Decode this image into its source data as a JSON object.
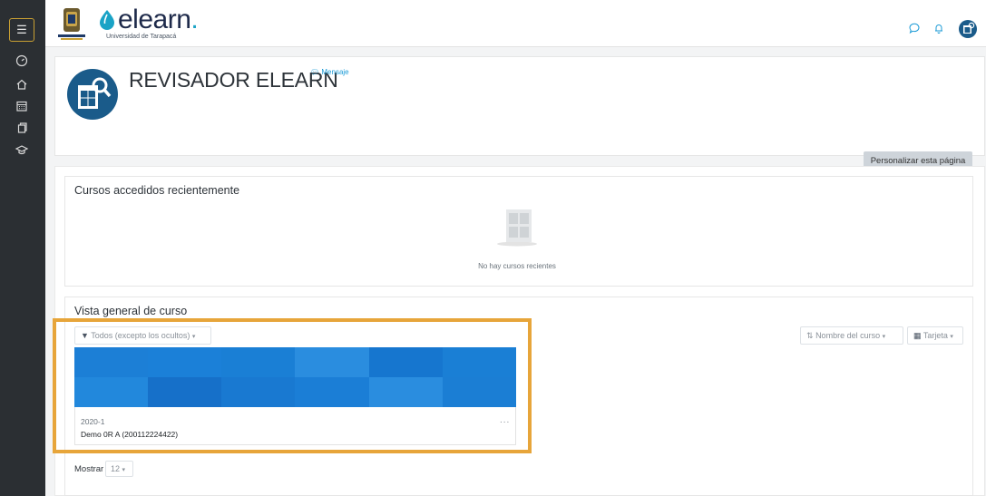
{
  "sidebar": {
    "menu_icon": "hamburger-icon",
    "items": [
      {
        "name": "dashboard",
        "icon": "gauge-icon"
      },
      {
        "name": "home",
        "icon": "home-icon"
      },
      {
        "name": "calendar",
        "icon": "calendar-icon"
      },
      {
        "name": "files",
        "icon": "files-icon"
      },
      {
        "name": "courses",
        "icon": "graduation-cap-icon"
      }
    ]
  },
  "header": {
    "logo_text": "elearn",
    "logo_dot": ".",
    "logo_subtitle": "Universidad de Tarapacá",
    "seal_text": "UNIVERSIDAD DE TARAPACÁ",
    "icons": [
      "chat-icon",
      "bell-icon",
      "user-avatar-icon"
    ]
  },
  "profile": {
    "name": "REVISADOR ELEARN",
    "message_link": "Mensaje",
    "customize_button": "Personalizar esta página"
  },
  "recent_courses": {
    "title": "Cursos accedidos recientemente",
    "empty_text": "No hay cursos recientes"
  },
  "course_overview": {
    "title": "Vista general de curso",
    "filter_label": "Todos (excepto los ocultos)",
    "sort_label": "Nombre del curso",
    "view_label": "Tarjeta",
    "courses": [
      {
        "term": "2020-1",
        "name": "Demo 0R  A (200112224422)",
        "menu": "..."
      }
    ],
    "show_label": "Mostrar",
    "show_value": "12"
  },
  "colors": {
    "highlight": "#e7a53a",
    "accent": "#1a9ad6",
    "sidebar": "#2b2f33"
  }
}
